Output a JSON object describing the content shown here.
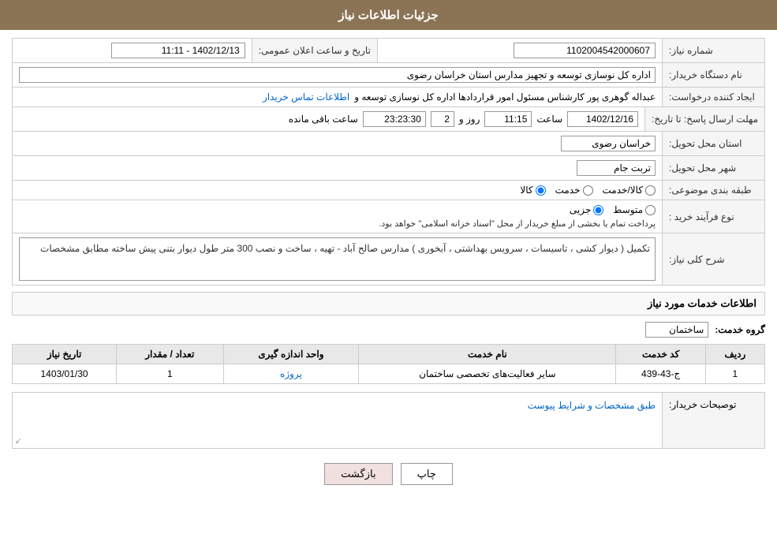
{
  "header": {
    "title": "جزئیات اطلاعات نیاز"
  },
  "fields": {
    "shomara_niyaz_label": "شماره نیاز:",
    "shomara_niyaz_value": "1102004542000607",
    "tarikh_label": "تاریخ و ساعت اعلان عمومی:",
    "tarikh_value": "1402/12/13 - 11:11",
    "nam_dastgah_label": "نام دستگاه خریدار:",
    "nam_dastgah_value": "اداره کل نوسازی  توسعه و تجهیز مدارس استان خراسان رضوی",
    "ijad_konande_label": "ایجاد کننده درخواست:",
    "ijad_konande_value": "عبداله گوهری پور کارشناس مسئول امور قراردادها  اداره کل نوسازی  توسعه و ",
    "ijad_konande_link": "اطلاعات تماس خریدار",
    "mohlat_label": "مهلت ارسال پاسخ: تا تاریخ:",
    "mohlat_date": "1402/12/16",
    "mohlat_saat": "11:15",
    "mohlat_rooz": "2",
    "mohlat_time": "23:23:30",
    "mohlat_baqi": "ساعت باقی مانده",
    "ostan_label": "استان محل تحویل:",
    "ostan_value": "خراسان رضوی",
    "shahr_label": "شهر محل تحویل:",
    "shahr_value": "تربت جام",
    "tabaqe_label": "طبقه بندی موضوعی:",
    "tabaqe_kala": "کالا",
    "tabaqe_khadamat": "خدمت",
    "tabaqe_kala_khadamat": "کالا/خدمت",
    "nooe_farayand_label": "نوع فرآیند خرید :",
    "nooe_jozii": "جزیی",
    "nooe_motevasset": "متوسط",
    "nooe_description": "پرداخت تمام یا بخشی از مبلغ خریدار از محل \"اسناد خزانه اسلامی\" خواهد بود.",
    "sharh_label": "شرح کلی نیاز:",
    "sharh_value": "تکمیل ( دیوار کشی ، تاسیسات ، سرویس بهداشتی ، آبخوری ) مدارس صالح آباد - تهیه ، ساخت و نصب 300 متر طول دیوار بتنی پیش ساخته مطابق مشخصات",
    "khadamat_section_title": "اطلاعات خدمات مورد نیاز",
    "goroh_khadamat_label": "گروه خدمت:",
    "goroh_khadamat_value": "ساختمان",
    "table": {
      "headers": [
        "ردیف",
        "کد خدمت",
        "نام خدمت",
        "واحد اندازه گیری",
        "تعداد / مقدار",
        "تاریخ نیاز"
      ],
      "rows": [
        {
          "radif": "1",
          "kod_khadamat": "ج-43-439",
          "nam_khadamat": "سایر فعالیت‌های تخصصی ساختمان",
          "vahad": "پروژه",
          "tedaad": "1",
          "tarikh_niyaz": "1403/01/30"
        }
      ]
    },
    "tosif_label": "توصیحات خریدار:",
    "tosif_value": "طبق مشخصات و شرایط پیوست"
  },
  "buttons": {
    "print_label": "چاپ",
    "back_label": "بازگشت"
  }
}
